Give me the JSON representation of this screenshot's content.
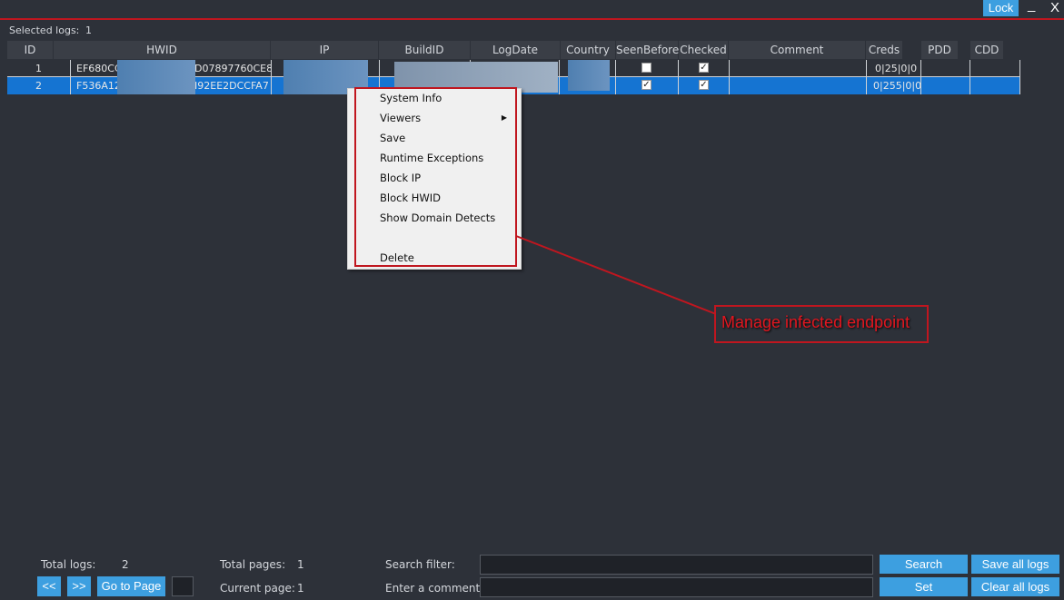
{
  "window": {
    "lock_label": "Lock",
    "minimize_label": "_",
    "close_label": "X"
  },
  "selection": {
    "label": "Selected logs:",
    "count": "1"
  },
  "table": {
    "columns": [
      "ID",
      "HWID",
      "IP",
      "BuildID",
      "LogDate",
      "Country",
      "SeenBefore",
      "Checked",
      "Comment",
      "Creds",
      "PDD",
      "CDD"
    ],
    "rows": [
      {
        "id": "1",
        "hwid_start": "EF680CC",
        "hwid_end": "D07897760CE8",
        "seen_before": false,
        "checked": true,
        "creds": "0|25|0|0"
      },
      {
        "id": "2",
        "hwid_start": "F536A12",
        "hwid_end": "I92EE2DCCFA7",
        "seen_before": true,
        "checked": true,
        "creds": "0|255|0|0"
      }
    ]
  },
  "context_menu": {
    "items": [
      "System Info",
      "Viewers",
      "Save",
      "Runtime Exceptions",
      "Block IP",
      "Block HWID",
      "Show Domain Detects",
      "Delete"
    ]
  },
  "annotation": {
    "text": "Manage infected endpoint"
  },
  "footer": {
    "total_logs_label": "Total logs:",
    "total_logs_value": "2",
    "total_pages_label": "Total pages:",
    "total_pages_value": "1",
    "current_page_label": "Current page:",
    "current_page_value": "1",
    "prev_label": "<<",
    "next_label": ">>",
    "goto_label": "Go to Page",
    "search_filter_label": "Search filter:",
    "comment_label": "Enter a comment:",
    "search_button": "Search",
    "set_button": "Set",
    "save_all_button": "Save all logs",
    "clear_all_button": "Clear all logs"
  },
  "colors": {
    "background": "#2d3139",
    "accent_blue": "#3d9fe0",
    "selection_blue": "#1574d2",
    "annotation_red": "#c0161f"
  }
}
